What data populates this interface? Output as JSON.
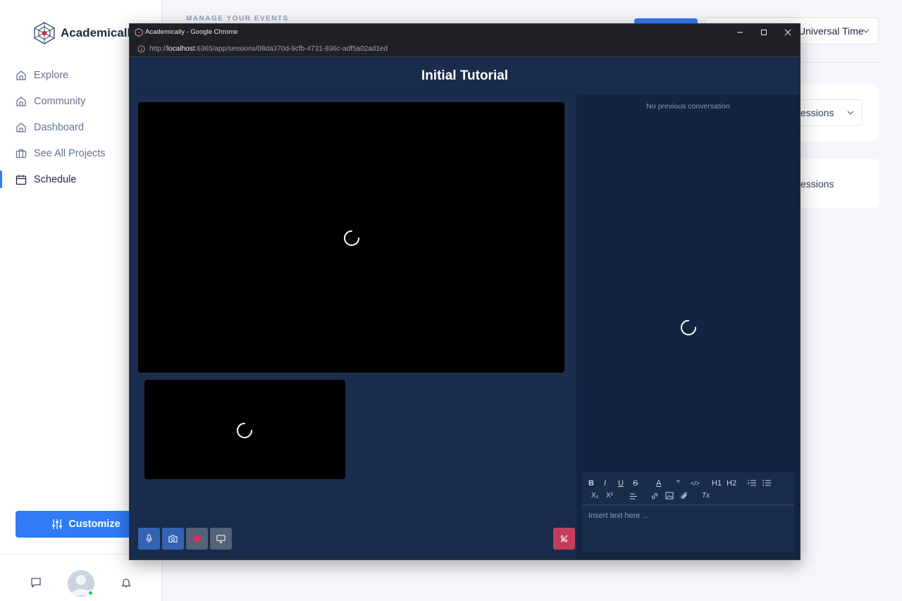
{
  "sidebar": {
    "brand": "Academically",
    "items": [
      {
        "label": "Explore",
        "icon": "home-icon"
      },
      {
        "label": "Community",
        "icon": "home-icon"
      },
      {
        "label": "Dashboard",
        "icon": "home-icon"
      },
      {
        "label": "See All Projects",
        "icon": "briefcase-icon"
      },
      {
        "label": "Schedule",
        "icon": "calendar-icon",
        "active": true
      }
    ],
    "customize_label": "Customize",
    "status_color": "#22c55e"
  },
  "main": {
    "caption": "MANAGE YOUR EVENTS",
    "timezone_label": "Universal Time",
    "card1_label": "essions",
    "card2_label": "essions"
  },
  "popup": {
    "window_title": "Academically - Google Chrome",
    "url_prefix": "http://",
    "url_host": "localhost",
    "url_rest": ":6365/app/sessions/08da370d-9cfb-4731-836c-adf5a02ad1ed",
    "session_title": "Initial Tutorial",
    "chat_empty": "No previous conversation",
    "editor_placeholder": "Insert text here ...",
    "toolbar": {
      "bold": "B",
      "italic": "I",
      "underline": "U",
      "strike": "S",
      "color": "A",
      "quote": "”",
      "code": "</>",
      "h1": "H1",
      "h2": "H2",
      "sub": "X₂",
      "sup": "X²",
      "clear": "Tx"
    }
  },
  "colors": {
    "accent": "#2f7cf6",
    "session_bg": "#1a2c4b",
    "chat_bg": "#142340",
    "leave": "#c43e5c"
  }
}
